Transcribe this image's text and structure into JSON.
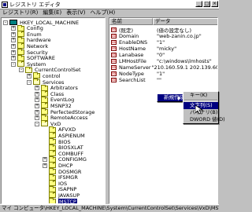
{
  "window": {
    "title": "レジストリ エディタ",
    "controls": [
      "_",
      "□",
      "×"
    ]
  },
  "menubar": [
    "レジストリ(R)",
    "編集(E)",
    "表示(V)",
    "ヘルプ(H)"
  ],
  "tree": [
    {
      "label": "HKEY_LOCAL_MACHINE",
      "icon": "computer",
      "expander": "-"
    },
    {
      "label": "Config",
      "icon": "folder",
      "expander": "+"
    },
    {
      "label": "Enum",
      "icon": "folder",
      "expander": "+"
    },
    {
      "label": "hardware",
      "icon": "folder",
      "expander": "+"
    },
    {
      "label": "Network",
      "icon": "folder",
      "expander": "+"
    },
    {
      "label": "Security",
      "icon": "folder",
      "expander": "+"
    },
    {
      "label": "SOFTWARE",
      "icon": "folder",
      "expander": "+"
    },
    {
      "label": "System",
      "icon": "folder-open",
      "expander": "-"
    },
    {
      "label": "CurrentControlSet",
      "icon": "folder-open",
      "expander": "-"
    },
    {
      "label": "control",
      "icon": "folder",
      "expander": "+"
    },
    {
      "label": "Services",
      "icon": "folder-open",
      "expander": "-"
    },
    {
      "label": "Arbitrators",
      "icon": "folder",
      "expander": "+"
    },
    {
      "label": "Class",
      "icon": "folder",
      "expander": "+"
    },
    {
      "label": "EventLog",
      "icon": "folder",
      "expander": "+"
    },
    {
      "label": "MSNP32",
      "icon": "folder",
      "expander": "+"
    },
    {
      "label": "PerfectedStorage",
      "icon": "folder",
      "expander": "+"
    },
    {
      "label": "RemoteAccess",
      "icon": "folder",
      "expander": "+"
    },
    {
      "label": "VxD",
      "icon": "folder-open",
      "expander": "-"
    },
    {
      "label": "AFVXD",
      "icon": "folder",
      "expander": ""
    },
    {
      "label": "ASPIENUM",
      "icon": "folder",
      "expander": ""
    },
    {
      "label": "BIOS",
      "icon": "folder",
      "expander": ""
    },
    {
      "label": "BIOSXLAT",
      "icon": "folder",
      "expander": ""
    },
    {
      "label": "COMBUFF",
      "icon": "folder",
      "expander": ""
    },
    {
      "label": "CONFIGMG",
      "icon": "folder",
      "expander": "+"
    },
    {
      "label": "DHCP",
      "icon": "folder",
      "expander": "+"
    },
    {
      "label": "DOSMGR",
      "icon": "folder",
      "expander": ""
    },
    {
      "label": "IFSMGR",
      "icon": "folder",
      "expander": ""
    },
    {
      "label": "IOS",
      "icon": "folder",
      "expander": ""
    },
    {
      "label": "ISAPNP",
      "icon": "folder",
      "expander": ""
    },
    {
      "label": "JAVASUP",
      "icon": "folder",
      "expander": ""
    },
    {
      "label": "MSTCP",
      "icon": "folder",
      "expander": "",
      "selected": true
    }
  ],
  "list": {
    "col_name": "名前",
    "col_data": "データ",
    "rows": [
      {
        "name": "(既定)",
        "data": "(値の設定なし)"
      },
      {
        "name": "Domain",
        "data": "\"web-zanin.co.jp\""
      },
      {
        "name": "EnableDNS",
        "data": "\"1\""
      },
      {
        "name": "HostName",
        "data": "\"micky\""
      },
      {
        "name": "Lanabase",
        "data": "\"0\""
      },
      {
        "name": "LMHostFile",
        "data": "\"c:\\windows\\lmhosts\""
      },
      {
        "name": "NameServer",
        "data": "\"210.160.59.1 202.139.60.60\""
      },
      {
        "name": "NodeType",
        "data": "\"1\""
      },
      {
        "name": "SearchList",
        "data": "\"\""
      }
    ]
  },
  "context_menu": {
    "items": [
      "新規作成(N)"
    ]
  },
  "submenu": {
    "items": [
      "キー(K)",
      "文字列(S)",
      "バイナリ(B)",
      "DWORD 値(D)"
    ],
    "highlighted": "文字列(S)"
  },
  "statusbar": "マイ コンピュータ\\HKEY_LOCAL_MACHINE\\System\\CurrentControlSet\\Services\\VxD\\MSTCP"
}
